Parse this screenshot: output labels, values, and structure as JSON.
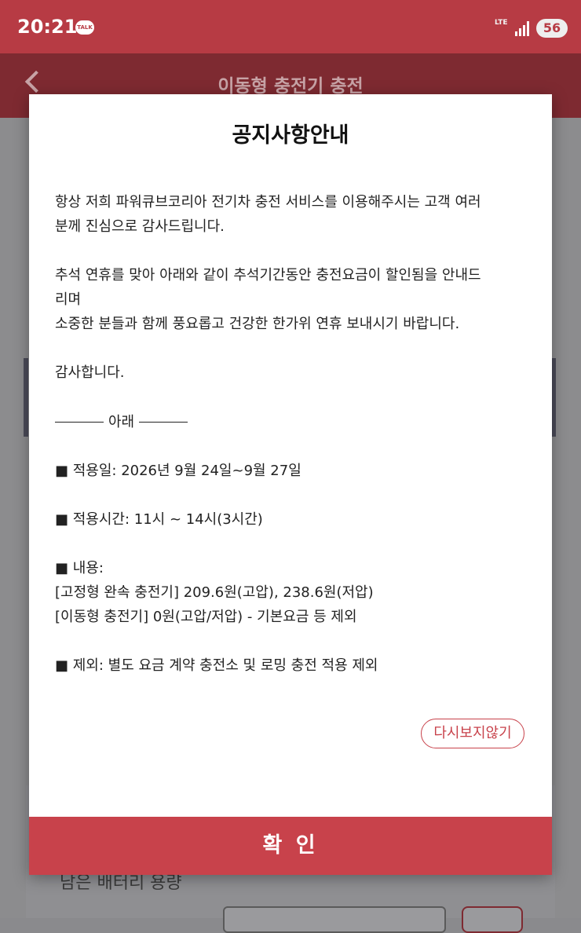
{
  "status_bar": {
    "time": "20:21",
    "talk_badge": "TALK",
    "network": "LTE",
    "battery": "56"
  },
  "header": {
    "title": "이동형 충전기 충전"
  },
  "background": {
    "label": "남은 배터리 용량"
  },
  "modal": {
    "title": "공지사항안내",
    "paragraphs": {
      "p1": [
        "항상 저희 파워큐브코리아 전기차 충전 서비스를 이용해주시는 고객 여러",
        "분께 진심으로 감사드립니다."
      ],
      "p2": [
        "추석 연휴를 맞아 아래와 같이 추석기간동안 충전요금이 할인됨을 안내드",
        "리며",
        "소중한 분들과 함께 풍요롭고 건강한 한가위 연휴 보내시기 바랍니다."
      ],
      "p3": "감사합니다.",
      "divider": "아래",
      "apply_date": "■ 적용일: 2026년 9월 24일~9월 27일",
      "apply_time": "■ 적용시간: 11시 ~ 14시(3시간)",
      "content_label": "■ 내용:",
      "content_1": "[고정형 완속 충전기] 209.6원(고압), 238.6원(저압)",
      "content_2": "[이동형 충전기] 0원(고압/저압) - 기본요금 등 제외",
      "exclusion": "■ 제외: 별도 요금 계약 충전소 및 로밍 충전 적용 제외"
    },
    "no_show_label": "다시보지않기",
    "confirm_label": "확 인"
  },
  "colors": {
    "status_bar": "#b73b44",
    "header": "#7e2a31",
    "accent": "#c8424b"
  }
}
